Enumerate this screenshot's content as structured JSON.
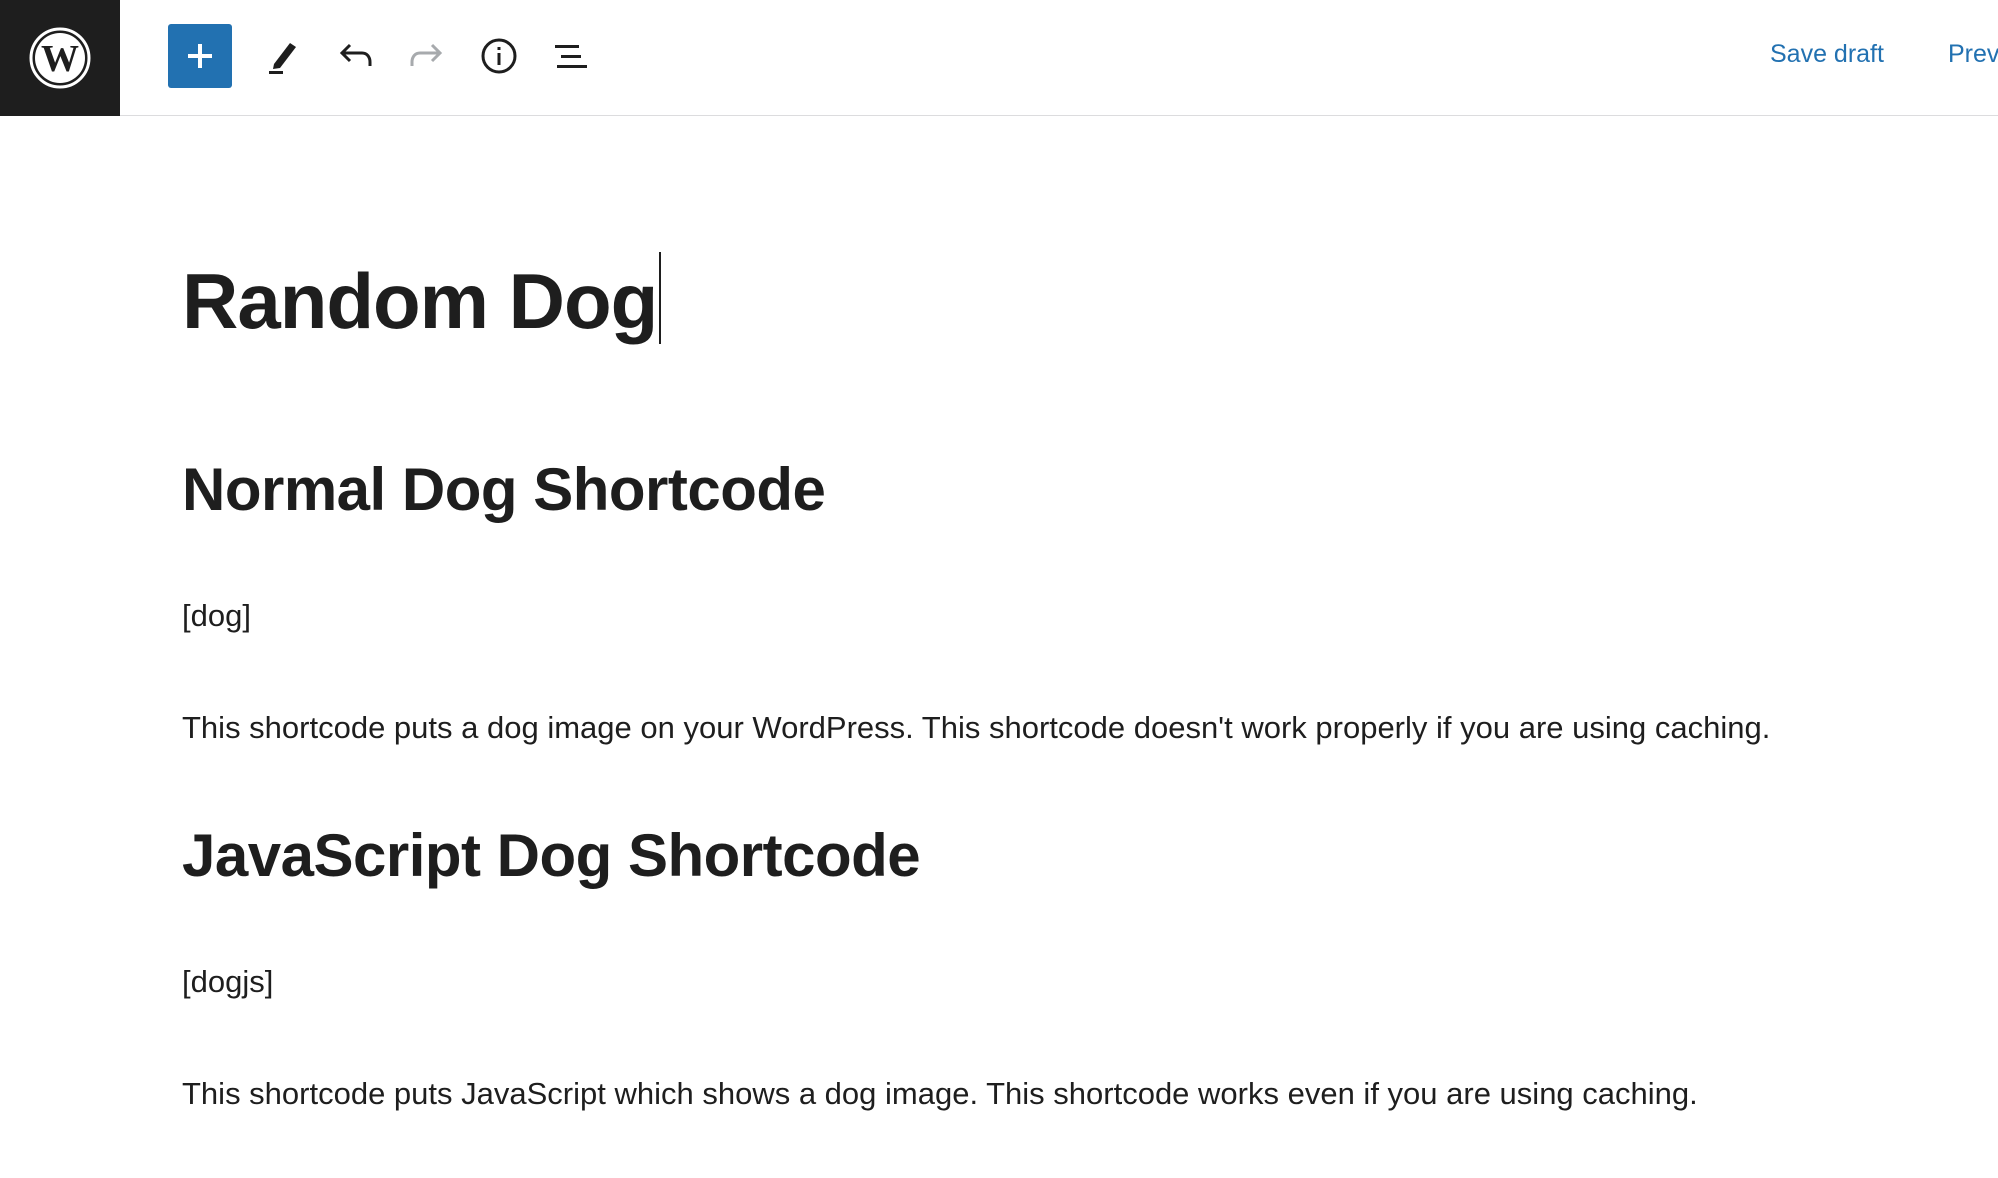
{
  "toolbar": {
    "logo_icon": "wordpress-logo-icon",
    "add_block_icon": "plus-icon",
    "tools_icon": "pencil-icon",
    "undo_icon": "undo-icon",
    "redo_icon": "redo-icon",
    "details_icon": "info-icon",
    "list_view_icon": "list-view-icon",
    "save_draft_label": "Save draft",
    "preview_label": "Preview",
    "colors": {
      "accent": "#2271b1",
      "logo_bg": "#1e1e1e"
    }
  },
  "post": {
    "title": "Random Dog",
    "blocks": [
      {
        "type": "heading",
        "text": "Normal Dog Shortcode"
      },
      {
        "type": "paragraph",
        "text": "[dog]"
      },
      {
        "type": "paragraph",
        "text": "This shortcode puts a dog image on your WordPress. This shortcode doesn't work properly if you are using caching."
      },
      {
        "type": "heading",
        "text": "JavaScript Dog Shortcode"
      },
      {
        "type": "paragraph",
        "text": "[dogjs]"
      },
      {
        "type": "paragraph",
        "text": "This shortcode puts JavaScript which shows a dog image. This shortcode works even if you are using caching."
      }
    ]
  }
}
